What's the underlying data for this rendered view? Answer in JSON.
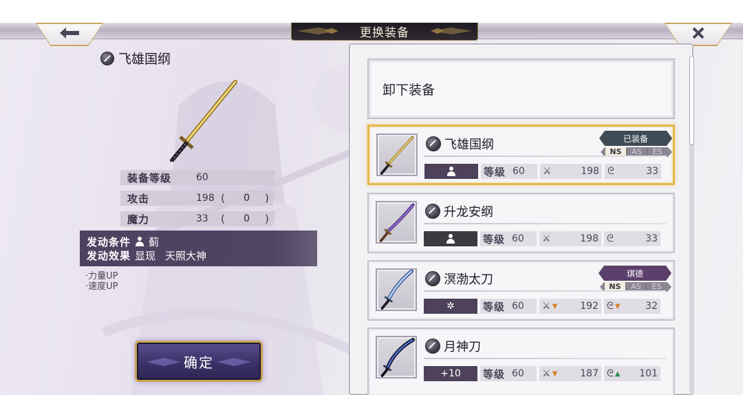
{
  "header": {
    "title": "更换装备",
    "back_icon": "left-arrow-icon",
    "close_icon": "close-icon"
  },
  "detail": {
    "weapon_name": "飞雄国纲",
    "weapon_icon": "katana-icon",
    "stats": {
      "level_label": "装备等级",
      "level_value": "60",
      "attack_label": "攻击",
      "attack_value": "198",
      "attack_bonus": "0",
      "magic_label": "魔力",
      "magic_value": "33",
      "magic_bonus": "0"
    },
    "skill": {
      "condition_label": "发动条件",
      "condition_value": "蓟",
      "effect_label": "发动效果",
      "effect_value_1": "显现",
      "effect_value_2": "天照大神"
    },
    "effects": [
      "·力量UP",
      "·速度UP"
    ],
    "confirm_label": "确定"
  },
  "list": {
    "unequip_label": "卸下装备",
    "items": [
      {
        "name": "飞雄国纲",
        "badge": "已装备",
        "tags": [
          "NS",
          "AS",
          "ES"
        ],
        "active_tag": "NS",
        "condition": "person-icon",
        "level_label": "等级",
        "level": "60",
        "attack": "198",
        "magic": "33",
        "selected": true
      },
      {
        "name": "升龙安纲",
        "condition": "person-icon",
        "level_label": "等级",
        "level": "60",
        "attack": "198",
        "magic": "33"
      },
      {
        "name": "溟渤太刀",
        "badge": "琪德",
        "tags": [
          "NS",
          "AS",
          "ES"
        ],
        "active_tag": "NS",
        "condition": "✲",
        "level_label": "等级",
        "level": "60",
        "attack": "192",
        "attack_change": "down",
        "magic": "32",
        "magic_change": "down"
      },
      {
        "name": "月神刀",
        "condition": "+10",
        "level_label": "等级",
        "level": "60",
        "attack": "187",
        "attack_change": "down",
        "magic": "101",
        "magic_change": "up"
      }
    ]
  },
  "colors": {
    "accent_gold": "#e5b84a",
    "panel_purple": "#4d4259",
    "down_arrow": "#d9822b",
    "up_arrow": "#2f8f5c"
  }
}
